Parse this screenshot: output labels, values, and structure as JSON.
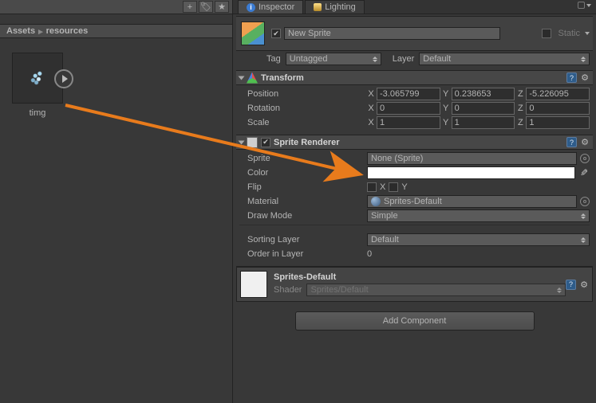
{
  "breadcrumb": {
    "root": "Assets",
    "folder": "resources"
  },
  "asset": {
    "name": "timg"
  },
  "tabs": {
    "inspector": "Inspector",
    "lighting": "Lighting"
  },
  "header": {
    "name": "New Sprite",
    "enabled": true,
    "static_label": "Static",
    "static_checked": false
  },
  "tagrow": {
    "tag_label": "Tag",
    "tag_value": "Untagged",
    "layer_label": "Layer",
    "layer_value": "Default"
  },
  "transform": {
    "title": "Transform",
    "rows": {
      "position": {
        "label": "Position",
        "x": "-3.065799",
        "y": "0.238653",
        "z": "-5.226095"
      },
      "rotation": {
        "label": "Rotation",
        "x": "0",
        "y": "0",
        "z": "0"
      },
      "scale": {
        "label": "Scale",
        "x": "1",
        "y": "1",
        "z": "1"
      }
    },
    "axes": {
      "x": "X",
      "y": "Y",
      "z": "Z"
    }
  },
  "sprite_renderer": {
    "title": "Sprite Renderer",
    "enabled": true,
    "sprite_label": "Sprite",
    "sprite_value": "None (Sprite)",
    "color_label": "Color",
    "flip_label": "Flip",
    "flip_x": "X",
    "flip_y": "Y",
    "material_label": "Material",
    "material_value": "Sprites-Default",
    "drawmode_label": "Draw Mode",
    "drawmode_value": "Simple",
    "sorting_label": "Sorting Layer",
    "sorting_value": "Default",
    "order_label": "Order in Layer",
    "order_value": "0"
  },
  "material": {
    "name": "Sprites-Default",
    "shader_label": "Shader",
    "shader_value": "Sprites/Default"
  },
  "add_component": "Add Component",
  "chart_data": null
}
